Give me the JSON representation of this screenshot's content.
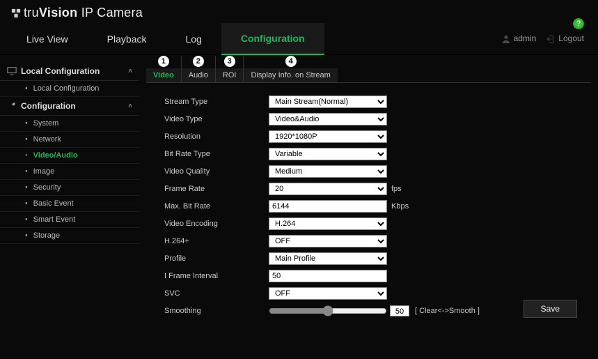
{
  "brand": {
    "prefix": "tru",
    "mid": "Vision",
    "suffix": " IP Camera"
  },
  "help_glyph": "?",
  "mainnav": {
    "tabs": [
      "Live View",
      "Playback",
      "Log",
      "Configuration"
    ],
    "active": 3
  },
  "user": {
    "name": "admin",
    "logout": "Logout"
  },
  "sidebar": {
    "groups": [
      {
        "title": "Local Configuration",
        "icon": "monitor",
        "expanded": true,
        "items": [
          {
            "label": "Local Configuration",
            "active": false
          }
        ]
      },
      {
        "title": "Configuration",
        "icon": "wrench",
        "expanded": true,
        "items": [
          {
            "label": "System",
            "active": false
          },
          {
            "label": "Network",
            "active": false
          },
          {
            "label": "Video/Audio",
            "active": true
          },
          {
            "label": "Image",
            "active": false
          },
          {
            "label": "Security",
            "active": false
          },
          {
            "label": "Basic Event",
            "active": false
          },
          {
            "label": "Smart Event",
            "active": false
          },
          {
            "label": "Storage",
            "active": false
          }
        ]
      }
    ]
  },
  "subtabs": {
    "items": [
      {
        "label": "Video",
        "callout": "1",
        "active": true
      },
      {
        "label": "Audio",
        "callout": "2",
        "active": false
      },
      {
        "label": "ROI",
        "callout": "3",
        "active": false
      },
      {
        "label": "Display Info. on Stream",
        "callout": "4",
        "active": false
      }
    ]
  },
  "form": {
    "stream_type": {
      "label": "Stream Type",
      "value": "Main Stream(Normal)"
    },
    "video_type": {
      "label": "Video Type",
      "value": "Video&Audio"
    },
    "resolution": {
      "label": "Resolution",
      "value": "1920*1080P"
    },
    "bit_rate_type": {
      "label": "Bit Rate Type",
      "value": "Variable"
    },
    "video_quality": {
      "label": "Video Quality",
      "value": "Medium"
    },
    "frame_rate": {
      "label": "Frame Rate",
      "value": "20",
      "unit": "fps"
    },
    "max_bit_rate": {
      "label": "Max. Bit Rate",
      "value": "6144",
      "unit": "Kbps"
    },
    "video_encoding": {
      "label": "Video Encoding",
      "value": "H.264"
    },
    "h264_plus": {
      "label": "H.264+",
      "value": "OFF"
    },
    "profile": {
      "label": "Profile",
      "value": "Main Profile"
    },
    "i_frame": {
      "label": "I Frame Interval",
      "value": "50"
    },
    "svc": {
      "label": "SVC",
      "value": "OFF"
    },
    "smoothing": {
      "label": "Smoothing",
      "value": "50",
      "hint": "[ Clear<->Smooth ]"
    }
  },
  "buttons": {
    "save": "Save"
  }
}
